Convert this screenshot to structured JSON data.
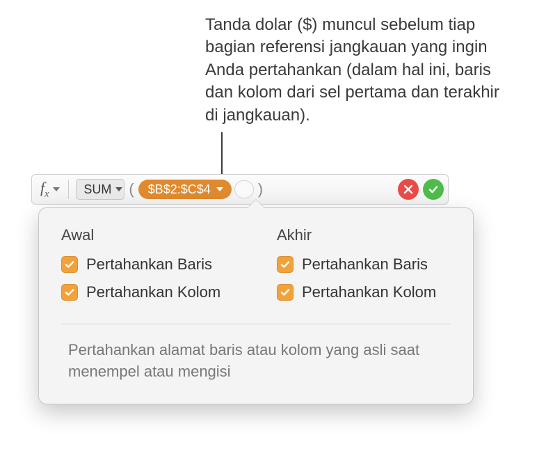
{
  "annotation": "Tanda dolar ($) muncul sebelum tiap bagian referensi jangkauan yang ingin Anda pertahankan (dalam hal ini, baris dan kolom dari sel pertama dan terakhir di jangkauan).",
  "formula_bar": {
    "fx_label": "f",
    "fx_sub": "x",
    "function_name": "SUM",
    "range_reference": "$B$2:$C$4"
  },
  "popover": {
    "start": {
      "heading": "Awal",
      "preserve_row": "Pertahankan Baris",
      "preserve_col": "Pertahankan Kolom"
    },
    "end": {
      "heading": "Akhir",
      "preserve_row": "Pertahankan Baris",
      "preserve_col": "Pertahankan Kolom"
    },
    "help_text": "Pertahankan alamat baris atau kolom yang asli saat menempel atau mengisi"
  }
}
